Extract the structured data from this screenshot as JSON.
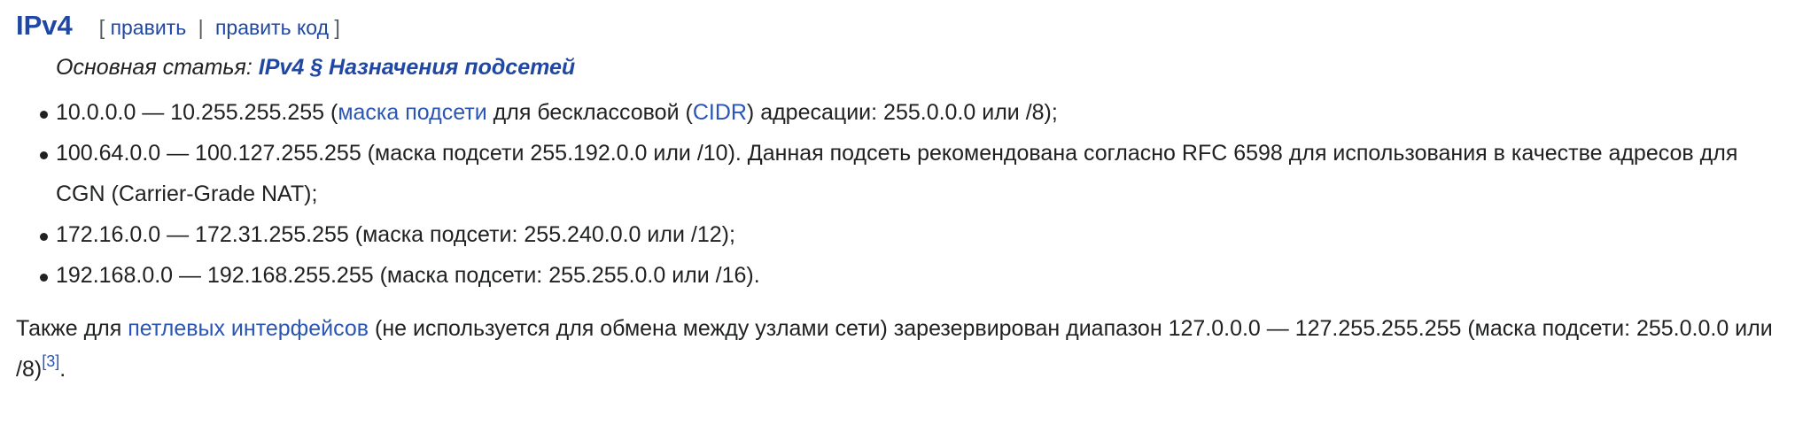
{
  "section": {
    "title": "IPv4",
    "edit": {
      "open_bracket": "[",
      "edit_label": "править",
      "separator": "|",
      "edit_code_label": "править код",
      "close_bracket": "]"
    }
  },
  "hatnote": {
    "prefix": "Основная статья: ",
    "link_label": "IPv4 § Назначения подсетей"
  },
  "list": {
    "item1": {
      "part1": "10.0.0.0 — 10.255.255.255 (",
      "link1": "маска подсети",
      "part2": " для бесклассовой (",
      "link2": "CIDR",
      "part3": ") адресации: 255.0.0.0 или /8);"
    },
    "item2": {
      "text": "100.64.0.0 — 100.127.255.255 (маска подсети 255.192.0.0 или /10). Данная подсеть рекомендована согласно RFC 6598 для использования в качестве адресов для CGN (Carrier-Grade NAT);"
    },
    "item3": {
      "text": "172.16.0.0 — 172.31.255.255 (маска подсети: 255.240.0.0 или /12);"
    },
    "item4": {
      "text": "192.168.0.0 — 192.168.255.255 (маска подсети: 255.255.0.0 или /16)."
    }
  },
  "paragraph": {
    "part1": "Также для ",
    "link": "петлевых интерфейсов",
    "part2": " (не используется для обмена между узлами сети) зарезервирован диапазон 127.0.0.0 — 127.255.255.255 (маска подсети: 255.0.0.0 или /8)",
    "ref": "[3]",
    "part3": "."
  }
}
